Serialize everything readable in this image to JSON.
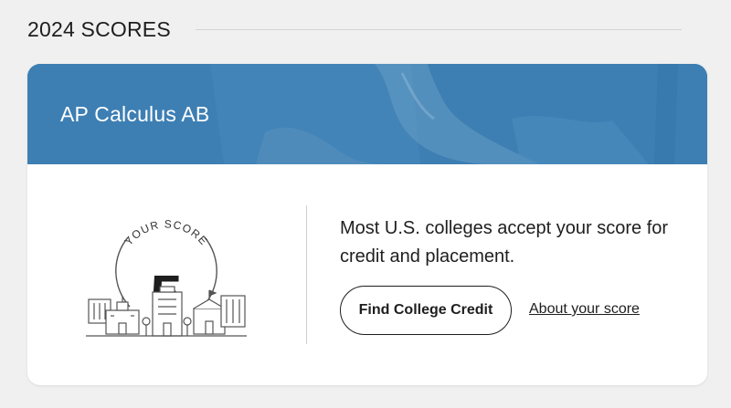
{
  "section": {
    "title": "2024 SCORES"
  },
  "card": {
    "title": "AP Calculus AB",
    "header_color": "#3d7fb3",
    "score": {
      "caption": "YOUR SCORE",
      "value": "5"
    },
    "message": "Most U.S. colleges accept your score for credit and placement.",
    "primary_button": "Find College Credit",
    "secondary_link": "About your score"
  }
}
